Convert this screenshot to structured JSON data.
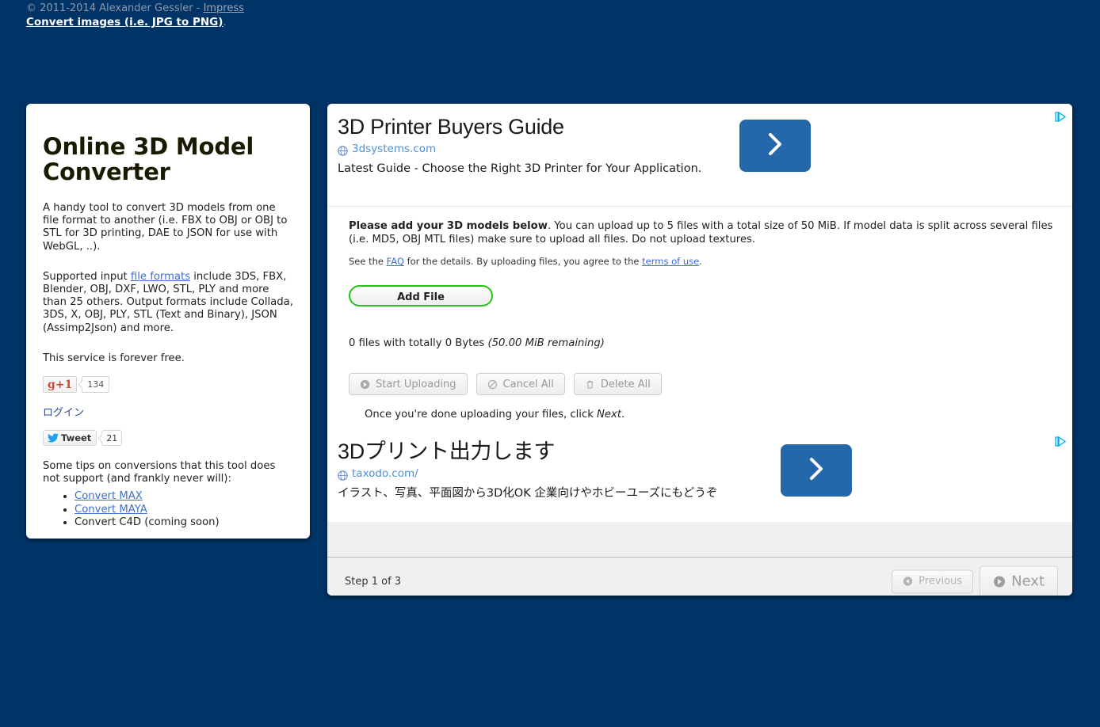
{
  "header": {
    "copyright": "© 2011-2014 Alexander Gessler - ",
    "impress_label": "Impress",
    "convert_images_label": "Convert images (i.e. JPG to PNG)",
    "trailing_dot": "."
  },
  "left_panel": {
    "title": "Online 3D Model Converter",
    "paragraph_1_a": "A handy tool to convert 3D models from one file format to another (i.e. FBX to OBJ or OBJ to STL for 3D printing, DAE to JSON for use with WebGL, ..).",
    "paragraph_2_pre": "Supported input ",
    "file_formats_link": "file formats",
    "paragraph_2_post": " include 3DS, FBX, Blender, OBJ, DXF, LWO, STL, PLY and more than 25 others. Output formats include Collada, 3DS, X, OBJ, PLY, STL (Text and Binary), JSON (Assimp2Json) and more.",
    "free_text": "This service is forever free.",
    "gplus_label": "g+1",
    "gplus_count": "134",
    "login_label": "ログイン",
    "tweet_label": "Tweet",
    "tweet_count": "21",
    "tips_intro": "Some tips on conversions that this tool does not support (and frankly never will):",
    "tips": [
      {
        "label": "Convert MAX",
        "is_link": true
      },
      {
        "label": "Convert MAYA",
        "is_link": true
      },
      {
        "label": "Convert C4D (coming soon)",
        "is_link": false
      }
    ]
  },
  "ads": [
    {
      "title": "3D Printer Buyers Guide",
      "url": "3dsystems.com",
      "description": "Latest Guide - Choose the Right 3D Printer for Your Application.",
      "arrow_icon": "chevron-right-icon",
      "adchoices_icon": "adchoices-icon",
      "accent_color": "#2467ab"
    },
    {
      "title": "3Dプリント出力します",
      "url": "taxodo.com/",
      "description": "イラスト、写真、平面図から3D化OK 企業向けやホビーユーズにもどうぞ",
      "arrow_icon": "chevron-right-icon",
      "adchoices_icon": "adchoices-icon",
      "accent_color": "#2467ab"
    }
  ],
  "main": {
    "instruction_bold": "Please add your 3D models below",
    "instruction_rest": ". You can upload up to 5 files with a total size of 50 MiB. If model data is split across several files (i.e. MD5, OBJ MTL files) make sure to upload all files. Do not upload textures.",
    "see_the": "See the ",
    "faq_link": "FAQ",
    "after_faq": " for the details. By uploading files, you agree to the ",
    "terms_link": "terms of use",
    "after_terms": ".",
    "add_file_label": "Add File",
    "files_summary_main": "0 files with totally 0 Bytes ",
    "files_summary_remaining": "(50.00 MiB remaining)",
    "actions": [
      {
        "label": "Start Uploading",
        "icon": "upload-circle-icon"
      },
      {
        "label": "Cancel All",
        "icon": "cancel-circle-icon"
      },
      {
        "label": "Delete All",
        "icon": "trash-icon"
      }
    ],
    "hint_pre": "Once you're done uploading your files, click ",
    "hint_em": "Next",
    "hint_post": "."
  },
  "footer": {
    "step_label": "Step 1 of 3",
    "previous_label": "Previous",
    "next_label": "Next"
  },
  "colors": {
    "page_background": "#003366",
    "panel_background": "#ffffff",
    "link_blue": "#3b6fd4",
    "add_file_green": "#22c416",
    "ad_blue": "#2467ab",
    "adchoices_cyan": "#00aeef"
  }
}
